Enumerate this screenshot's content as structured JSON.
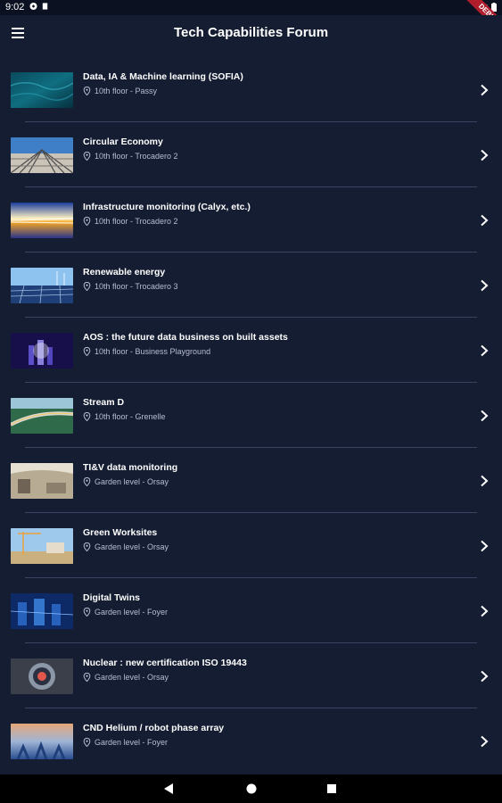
{
  "status_bar": {
    "time": "9:02",
    "debug_label": "DEBUG"
  },
  "app_bar": {
    "title": "Tech Capabilities Forum",
    "menu_icon": "hamburger-menu-icon"
  },
  "rows": [
    {
      "title": "Data, IA & Machine learning (SOFIA)",
      "location": "10th floor - Passy",
      "image": "ocean-waves"
    },
    {
      "title": "Circular Economy",
      "location": "10th floor - Trocadero 2",
      "image": "steel-structure"
    },
    {
      "title": "Infrastructure monitoring (Calyx, etc.)",
      "location": "10th floor - Trocadero 2",
      "image": "light-trails"
    },
    {
      "title": "Renewable energy",
      "location": "10th floor - Trocadero 3",
      "image": "solar-panels"
    },
    {
      "title": "AOS : the future data business on built assets",
      "location": "10th floor - Business Playground",
      "image": "digital-city"
    },
    {
      "title": "Stream D",
      "location": "10th floor - Grenelle",
      "image": "highway-bridge"
    },
    {
      "title": "TI&V data monitoring",
      "location": "Garden level - Orsay",
      "image": "tunnel-interior"
    },
    {
      "title": "Green Worksites",
      "location": "Garden level - Orsay",
      "image": "construction-site"
    },
    {
      "title": "Digital Twins",
      "location": "Garden level - Foyer",
      "image": "digital-network"
    },
    {
      "title": "Nuclear : new certification ISO 19443",
      "location": "Garden level - Orsay",
      "image": "reactor-core"
    },
    {
      "title": "CND Helium / robot phase array",
      "location": "Garden level - Foyer",
      "image": "robot-arms"
    }
  ],
  "colors": {
    "background": "#151d33",
    "divider": "#3a4360",
    "subtitle": "#b8bed0"
  }
}
